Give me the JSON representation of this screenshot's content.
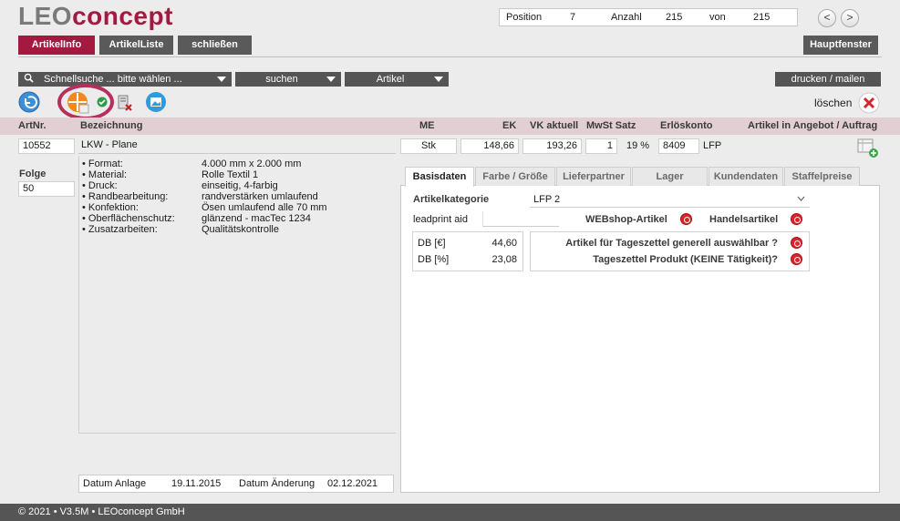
{
  "logo": {
    "part1": "LEO",
    "part2": "concept"
  },
  "position_bar": {
    "position_label": "Position",
    "position_value": "7",
    "anzahl_label": "Anzahl",
    "anzahl_value": "215",
    "von_label": "von",
    "von_value": "215",
    "prev": "<",
    "next": ">"
  },
  "top_tabs": {
    "artikelinfo": "ArtikelInfo",
    "artikelliste": "ArtikelListe",
    "schliessen": "schließen",
    "hauptfenster": "Hauptfenster"
  },
  "toolbar": {
    "quick_search": "Schnellsuche ... bitte wählen ...",
    "suchen": "suchen",
    "artikel": "Artikel",
    "drucken": "drucken / mailen",
    "loeschen": "löschen"
  },
  "headers": {
    "artnr": "ArtNr.",
    "bezeichnung": "Bezeichnung",
    "me": "ME",
    "ek": "EK",
    "vk": "VK aktuell",
    "mwst": "MwSt Satz",
    "erloes": "Erlöskonto",
    "angebot": "Artikel in Angebot / Auftrag"
  },
  "article": {
    "artnr": "10552",
    "bezeichnung": "LKW - Plane",
    "me": "Stk",
    "ek": "148,66",
    "vk": "193,26",
    "mwst_code": "1",
    "mwst_pct": "19 %",
    "erloes_konto": "8409",
    "erloes_label": "LFP",
    "folge_label": "Folge",
    "folge_value": "50"
  },
  "description": [
    {
      "key": "• Format:",
      "val": "4.000 mm x 2.000 mm"
    },
    {
      "key": "• Material:",
      "val": "Rolle Textil 1"
    },
    {
      "key": "• Druck:",
      "val": "einseitig, 4-farbig"
    },
    {
      "key": "• Randbearbeitung:",
      "val": "randverstärken umlaufend"
    },
    {
      "key": "• Konfektion:",
      "val": "Ösen umlaufend alle 70 mm"
    },
    {
      "key": "• Oberflächenschutz:",
      "val": "glänzend - macTec 1234"
    },
    {
      "key": "• Zusatzarbeiten:",
      "val": "Qualitätskontrolle"
    }
  ],
  "dates": {
    "anlage_label": "Datum Anlage",
    "anlage_value": "19.11.2015",
    "aenderung_label": "Datum Änderung",
    "aenderung_value": "02.12.2021"
  },
  "tabs": [
    "Basisdaten",
    "Farbe / Größe",
    "Lieferpartner",
    "Lager",
    "Kundendaten",
    "Staffelpreise"
  ],
  "basisdaten": {
    "kategorie_label": "Artikelkategorie",
    "kategorie_value": "LFP 2",
    "leadprint_label": "leadprint aid",
    "leadprint_value": "",
    "webshop_label": "WEBshop-Artikel",
    "handels_label": "Handelsartikel",
    "db_eur_label": "DB [€]",
    "db_eur_value": "44,60",
    "db_pct_label": "DB [%]",
    "db_pct_value": "23,08",
    "tageszettel_label": "Artikel für Tageszettel generell auswählbar ?",
    "tageszettel_produkt_label": "Tageszettel Produkt (KEINE Tätigkeit)?"
  },
  "footer": "© 2021 • V3.5M • LEOconcept GmbH"
}
